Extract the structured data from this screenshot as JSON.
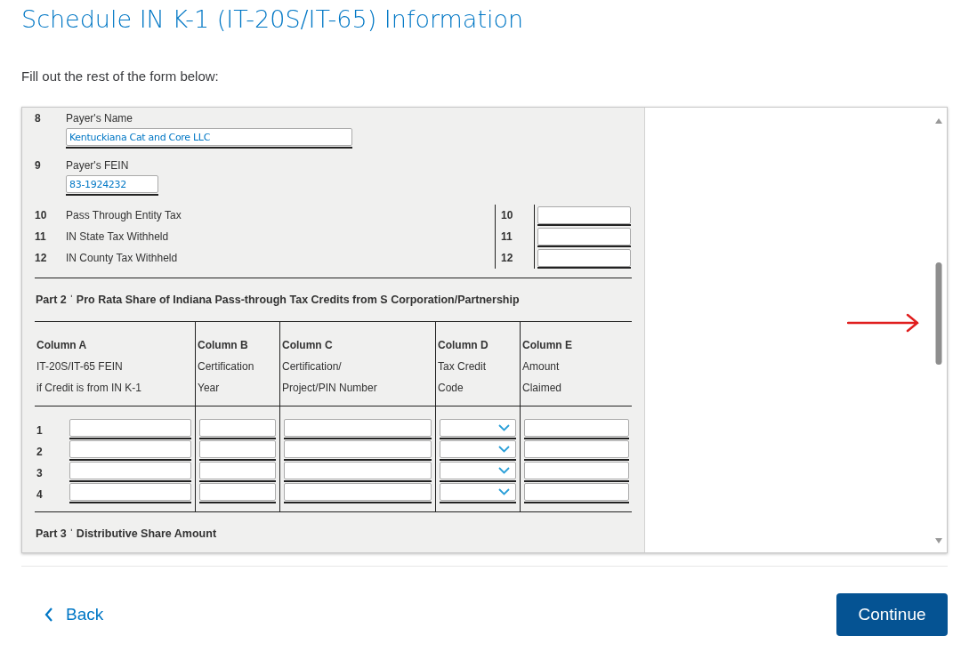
{
  "page": {
    "title": "Schedule IN K-1 (IT-20S/IT-65) Information",
    "instruction": "Fill out the rest of the form below:"
  },
  "form": {
    "payer_lines": [
      {
        "line": "8",
        "label": "Payer's Name",
        "value": "Kentuckiana Cat and Core LLC"
      },
      {
        "line": "9",
        "label": "Payer's FEIN",
        "value": "83-1924232"
      }
    ],
    "amount_lines": [
      {
        "line": "10",
        "label": "Pass Through Entity Tax",
        "box_number": "10"
      },
      {
        "line": "11",
        "label": "IN State Tax Withheld",
        "box_number": "11"
      },
      {
        "line": "12",
        "label": "IN County Tax Withheld",
        "box_number": "12"
      }
    ],
    "part2": {
      "part": "Part 2 ˈ",
      "title": "Pro Rata Share of Indiana Pass-through Tax Credits from S Corporation/Partnership",
      "columns": [
        {
          "heading": "Column A",
          "lines": [
            "IT-20S/IT-65 FEIN",
            "if Credit is from IN K-1"
          ],
          "kind": "text"
        },
        {
          "heading": "Column B",
          "lines": [
            "Certification",
            "Year"
          ],
          "kind": "text"
        },
        {
          "heading": "Column C",
          "lines": [
            "Certification/",
            "Project/PIN Number"
          ],
          "kind": "text"
        },
        {
          "heading": "Column D",
          "lines": [
            "Tax Credit",
            "Code"
          ],
          "kind": "select"
        },
        {
          "heading": "Column E",
          "lines": [
            "Amount",
            "Claimed"
          ],
          "kind": "text"
        }
      ],
      "rows": [
        {
          "line": "1"
        },
        {
          "line": "2"
        },
        {
          "line": "3"
        },
        {
          "line": "4"
        }
      ]
    },
    "part3": {
      "part": "Part 3 ˈ",
      "title": "Distributive Share Amount"
    }
  },
  "actions": {
    "back": "Back",
    "continue": "Continue"
  }
}
